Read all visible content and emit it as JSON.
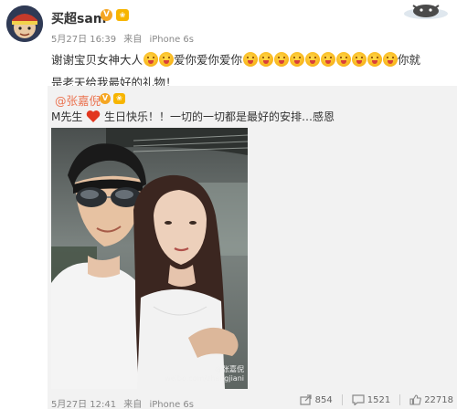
{
  "post": {
    "username": "买超sam",
    "verified_badge": "V",
    "member_badge": "❀",
    "meta": {
      "date": "5月27日 16:39",
      "source_prefix": "来自",
      "source": "iPhone 6s"
    },
    "content": {
      "line1_a": "谢谢宝贝女神大人",
      "line1_b": "爱你爱你爱你",
      "line1_c": "你就",
      "line2": "是老天给我最好的礼物！"
    }
  },
  "repost": {
    "mention": "@张嘉倪",
    "verified_badge": "V",
    "member_badge": "❀",
    "text_a": "M先生",
    "text_b": "生日快乐！！一切的一切都是最好的安排…感恩",
    "watermark_line1": "@张嘉倪",
    "watermark_line2": "weibo.com/zhangjiani",
    "meta": {
      "date": "5月27日 12:41",
      "source_prefix": "来自",
      "source": "iPhone 6s"
    },
    "actions": {
      "share_count": "854",
      "comment_count": "1521",
      "like_count": "22718"
    }
  },
  "icons": [
    "avatar",
    "verified-icon",
    "member-icon",
    "emoji-icon",
    "heart-icon",
    "share-icon",
    "comment-icon",
    "like-icon"
  ],
  "colors": {
    "mention": "#eb7350",
    "badge": "#f5a623",
    "repost_bg": "#f2f2f2",
    "meta": "#888888"
  }
}
